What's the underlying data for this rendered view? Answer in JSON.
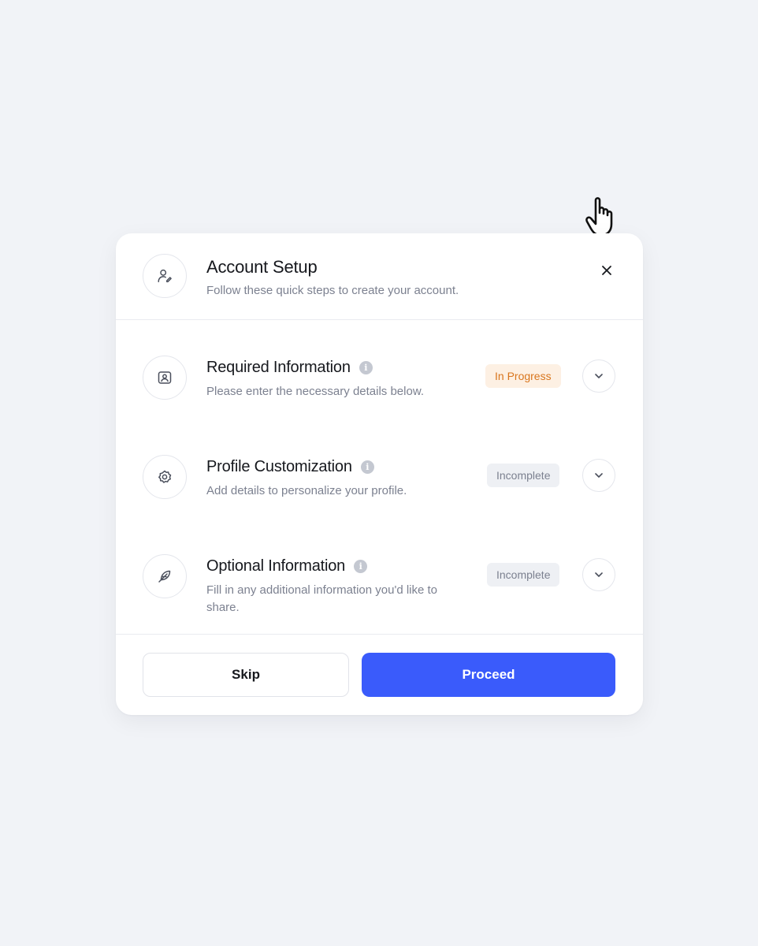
{
  "header": {
    "title": "Account Setup",
    "subtitle": "Follow these quick steps to create your account.",
    "icon": "user-icon",
    "close_icon": "close-icon"
  },
  "steps": [
    {
      "title": "Required Information",
      "description": "Please enter the necessary details below.",
      "status": "In Progress",
      "icon": "id-card-icon"
    },
    {
      "title": "Profile Customization",
      "description": "Add details to personalize your profile.",
      "status": "Incomplete",
      "icon": "badge-icon"
    },
    {
      "title": "Optional Information",
      "description": "Fill in any additional information you'd like to share.",
      "status": "Incomplete",
      "icon": "feather-icon"
    }
  ],
  "info_glyph": "i",
  "footer": {
    "skip_label": "Skip",
    "proceed_label": "Proceed"
  },
  "colors": {
    "background": "#f1f3f7",
    "primary": "#3a5bfb",
    "in_progress_text": "#d9761e",
    "in_progress_bg": "#fdf0e3",
    "incomplete_text": "#7c8190",
    "incomplete_bg": "#eef0f4"
  }
}
